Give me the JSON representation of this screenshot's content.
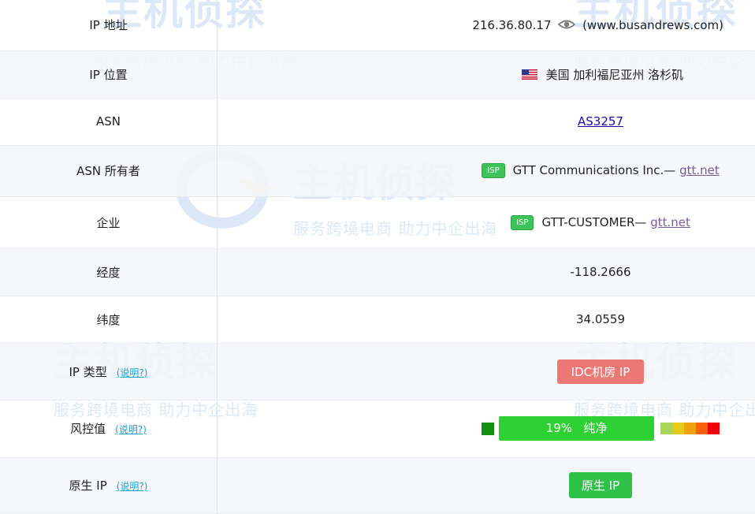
{
  "watermark": {
    "title": "主机侦探",
    "slogan": "服务跨境电商  助力中企出海"
  },
  "rows": {
    "ip_address": {
      "label": "IP 地址",
      "ip": "216.36.80.17",
      "host": "(www.busandrews.com)"
    },
    "ip_location": {
      "label": "IP 位置",
      "flag": "us-flag",
      "value": "美国 加利福尼亚州 洛杉矶"
    },
    "asn": {
      "label": "ASN",
      "value": "AS3257"
    },
    "asn_owner": {
      "label": "ASN 所有者",
      "badge": "ISP",
      "name": "GTT Communications Inc.—",
      "domain": "gtt.net"
    },
    "enterprise": {
      "label": "企业",
      "badge": "ISP",
      "name": "GTT-CUSTOMER—",
      "domain": "gtt.net"
    },
    "longitude": {
      "label": "经度",
      "value": "-118.2666"
    },
    "latitude": {
      "label": "纬度",
      "value": "34.0559"
    },
    "ip_type": {
      "label": "IP 类型",
      "help": "(说明?)",
      "value": "IDC机房 IP",
      "color": "#ec7876"
    },
    "risk": {
      "label": "风控值",
      "help": "(说明?)",
      "score": "19%",
      "status": "纯净",
      "percent": 19,
      "scale_colors": [
        "#a8d55a",
        "#e5cc1a",
        "#f2a20d",
        "#f7620a",
        "#f00000"
      ]
    },
    "native_ip": {
      "label": "原生 IP",
      "help": "(说明?)",
      "value": "原生 IP",
      "color": "#2ec24a"
    }
  }
}
